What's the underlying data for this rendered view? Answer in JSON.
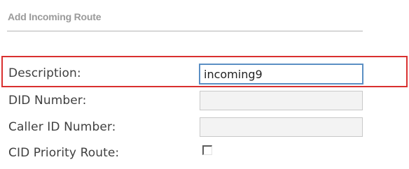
{
  "section": {
    "title": "Add Incoming Route"
  },
  "form": {
    "description": {
      "label": "Description:",
      "value": "incoming9"
    },
    "did_number": {
      "label": "DID Number:",
      "value": ""
    },
    "caller_id_number": {
      "label": "Caller ID Number:",
      "value": ""
    },
    "cid_priority_route": {
      "label": "CID Priority Route:",
      "checked": false
    }
  },
  "colors": {
    "highlight": "#d9302f",
    "focus_border": "#5b8fc4",
    "label_text": "#3f3f3f",
    "title_text": "#9a9a9a"
  }
}
